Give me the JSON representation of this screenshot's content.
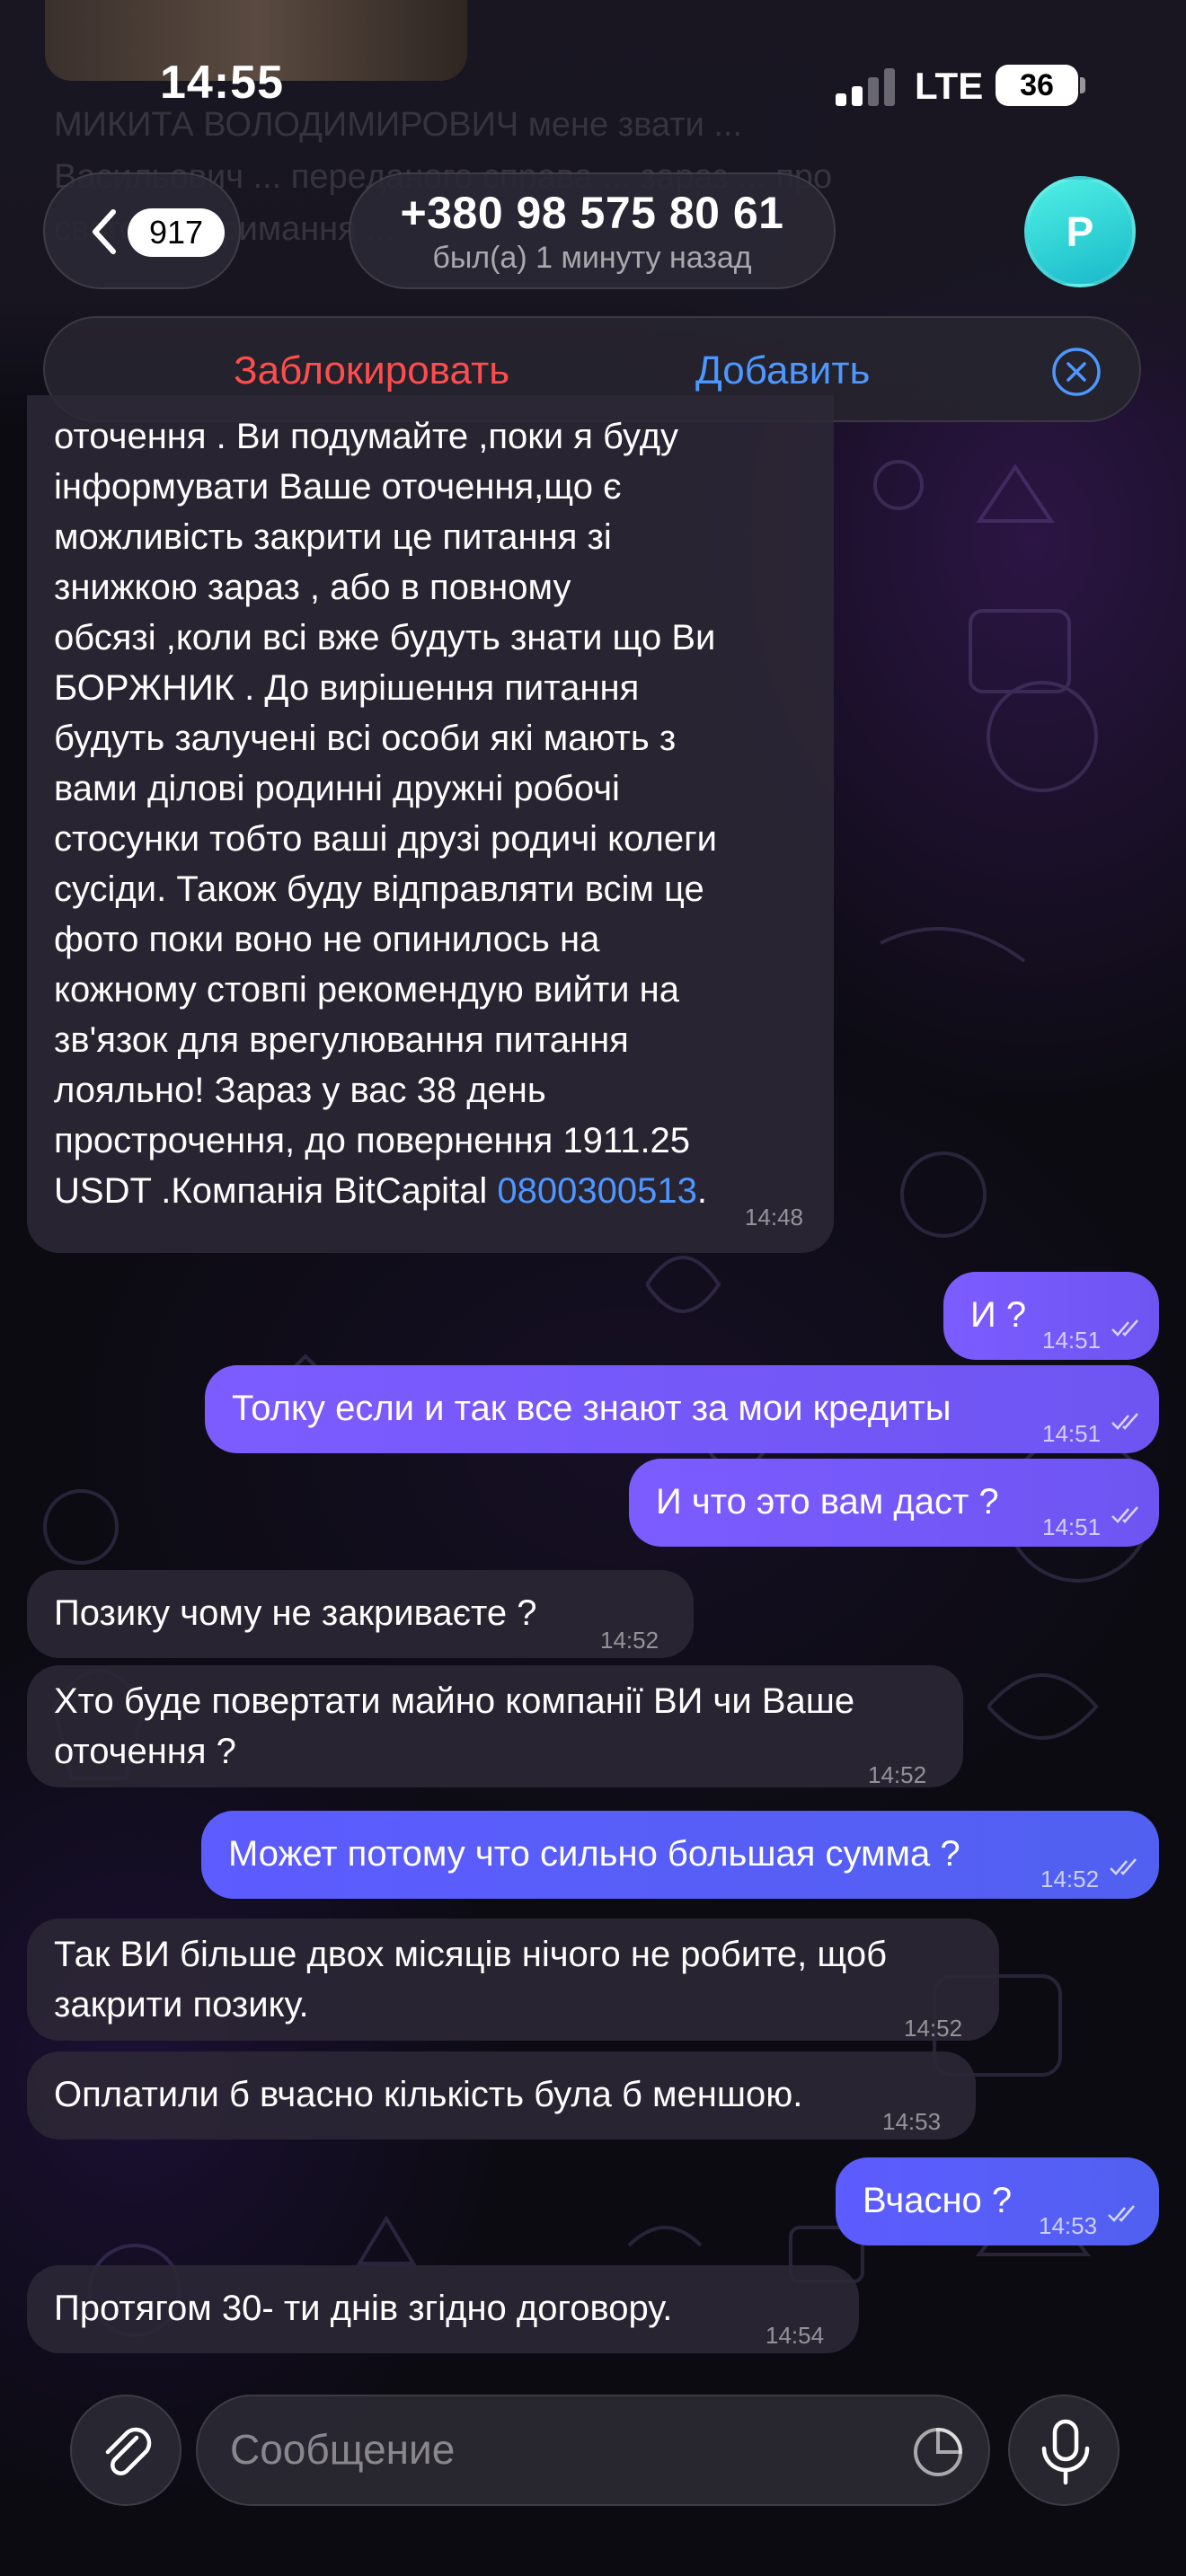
{
  "status_bar": {
    "time": "14:55",
    "network": "LTE",
    "battery": "36"
  },
  "background_message_fragment": "МИКИТА ВОЛОДИМИРОВИЧ мене звати ... Васильович ... переданого справа ... зараз ... про свого ... отримання ...",
  "header": {
    "back_badge": "917",
    "contact_name": "+380 98 575 80 61",
    "last_seen": "был(а) 1 минуту назад",
    "avatar_letter": "P"
  },
  "action_bar": {
    "block_label": "Заблокировать",
    "add_label": "Добавить"
  },
  "messages": [
    {
      "direction": "incoming",
      "lines": [
        "оточення . Ви подумайте ,поки я буду",
        "інформувати Ваше оточення,що є",
        "можливість закрити це питання зі",
        "знижкою зараз , або в повному",
        "обсязі ,коли всі вже будуть знати що Ви",
        "БОРЖНИК . До вирішення питання",
        "будуть залучені всі особи які мають з",
        "вами ділові родинні дружні робочі",
        "стосунки тобто ваші друзі родичі колеги",
        "сусіди. Також буду відправляти всім це",
        "фото поки воно не опинилось на",
        "кожному стовпі рекомендую вийти на",
        "зв'язок для врегулювання питання",
        "лояльно! Зараз у вас 38 день",
        "прострочення, до повернення 1911.25"
      ],
      "last_line_prefix": "USDT .Компанія BitCapital ",
      "last_line_link": "0800300513",
      "last_line_suffix": ".",
      "time": "14:48"
    },
    {
      "direction": "outgoing",
      "text": "И ?",
      "time": "14:51",
      "status": "read"
    },
    {
      "direction": "outgoing",
      "text": "Толку если и так все знают за мои кредиты",
      "time": "14:51",
      "status": "read"
    },
    {
      "direction": "outgoing",
      "text": "И что это вам даст ?",
      "time": "14:51",
      "status": "read"
    },
    {
      "direction": "incoming",
      "text": "Позику чому не закриваєте ?",
      "time": "14:52"
    },
    {
      "direction": "incoming",
      "lines": [
        "Хто буде повертати майно компанії ВИ чи Ваше",
        "оточення ?"
      ],
      "time": "14:52"
    },
    {
      "direction": "outgoing",
      "text": "Может потому что сильно большая сумма ?",
      "time": "14:52",
      "status": "read"
    },
    {
      "direction": "incoming",
      "lines": [
        "Так ВИ більше двох місяців нічого не робите, щоб",
        "закрити позику."
      ],
      "time": "14:52"
    },
    {
      "direction": "incoming",
      "text": "Оплатили б вчасно кількість була б меншою.",
      "time": "14:53"
    },
    {
      "direction": "outgoing",
      "text": "Вчасно ?",
      "time": "14:53",
      "status": "read"
    },
    {
      "direction": "incoming",
      "text": "Протягом 30- ти днів згідно договору.",
      "time": "14:54"
    }
  ],
  "input_bar": {
    "placeholder": "Сообщение"
  },
  "colors": {
    "outgoing_bubble": "#7c5cff",
    "incoming_bubble": "#2c2836",
    "block_red": "#ff4d4d",
    "link_blue": "#4d97ff",
    "avatar_teal": "#2fd3d6"
  }
}
